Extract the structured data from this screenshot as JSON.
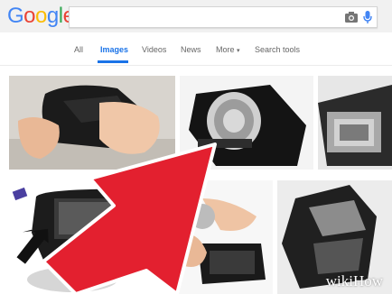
{
  "logo": {
    "letters": [
      "G",
      "o",
      "o",
      "g",
      "l",
      "e"
    ],
    "colors": [
      "#4285f4",
      "#ea4335",
      "#fbbc05",
      "#4285f4",
      "#34a853",
      "#ea4335"
    ]
  },
  "search": {
    "value": ""
  },
  "tabs": [
    {
      "label": "All",
      "active": false
    },
    {
      "label": "Images",
      "active": true
    },
    {
      "label": "Videos",
      "active": false
    },
    {
      "label": "News",
      "active": false
    },
    {
      "label": "More",
      "active": false,
      "caret": "▾"
    },
    {
      "label": "Search tools",
      "active": false
    }
  ],
  "accent": "#1a73e8",
  "arrow_color": "#e3202f",
  "watermark": {
    "text": "wikiHow"
  }
}
